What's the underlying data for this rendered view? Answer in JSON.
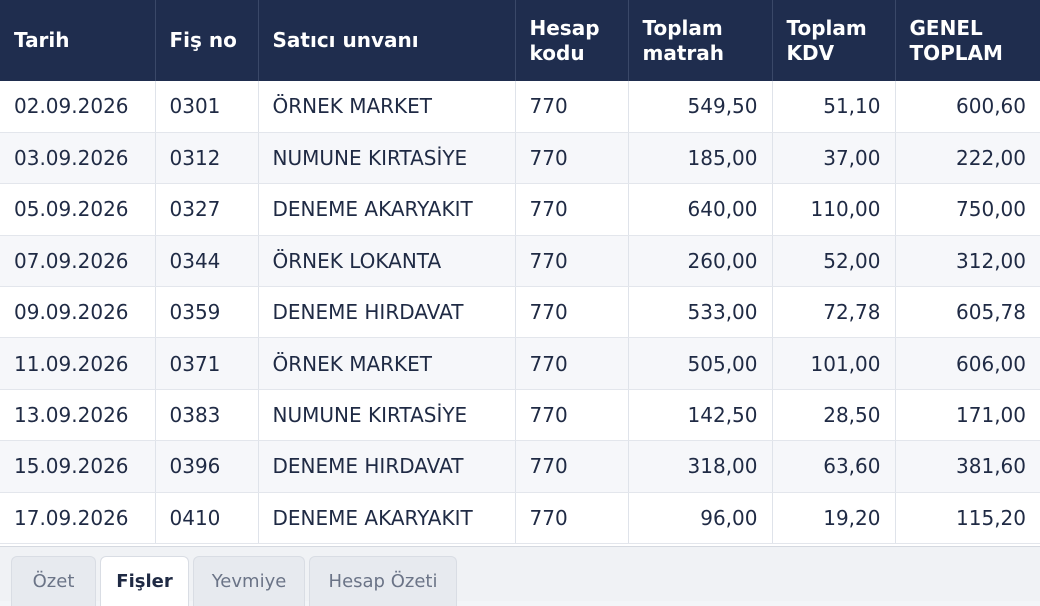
{
  "table": {
    "headers": [
      [
        "Tarih"
      ],
      [
        "Fiş no"
      ],
      [
        "Satıcı unvanı"
      ],
      [
        "Hesap",
        "kodu"
      ],
      [
        "Toplam",
        "matrah"
      ],
      [
        "Toplam",
        "KDV"
      ],
      [
        "GENEL",
        "TOPLAM"
      ]
    ],
    "rows": [
      [
        "02.09.2026",
        "0301",
        "ÖRNEK MARKET",
        "770",
        "549,50",
        "51,10",
        "600,60"
      ],
      [
        "03.09.2026",
        "0312",
        "NUMUNE KIRTASİYE",
        "770",
        "185,00",
        "37,00",
        "222,00"
      ],
      [
        "05.09.2026",
        "0327",
        "DENEME AKARYAKIT",
        "770",
        "640,00",
        "110,00",
        "750,00"
      ],
      [
        "07.09.2026",
        "0344",
        "ÖRNEK LOKANTA",
        "770",
        "260,00",
        "52,00",
        "312,00"
      ],
      [
        "09.09.2026",
        "0359",
        "DENEME HIRDAVAT",
        "770",
        "533,00",
        "72,78",
        "605,78"
      ],
      [
        "11.09.2026",
        "0371",
        "ÖRNEK MARKET",
        "770",
        "505,00",
        "101,00",
        "606,00"
      ],
      [
        "13.09.2026",
        "0383",
        "NUMUNE KIRTASİYE",
        "770",
        "142,50",
        "28,50",
        "171,00"
      ],
      [
        "15.09.2026",
        "0396",
        "DENEME HIRDAVAT",
        "770",
        "318,00",
        "63,60",
        "381,60"
      ],
      [
        "17.09.2026",
        "0410",
        "DENEME AKARYAKIT",
        "770",
        "96,00",
        "19,20",
        "115,20"
      ]
    ]
  },
  "tabs": [
    {
      "label": "Özet",
      "active": false
    },
    {
      "label": "Fişler",
      "active": true
    },
    {
      "label": "Yevmiye",
      "active": false
    },
    {
      "label": "Hesap Özeti",
      "active": false
    }
  ],
  "colors": {
    "header_bg": "#1f2d4e",
    "header_text": "#ffffff",
    "row_alt": "#f6f7fa",
    "text": "#1f2a44"
  }
}
